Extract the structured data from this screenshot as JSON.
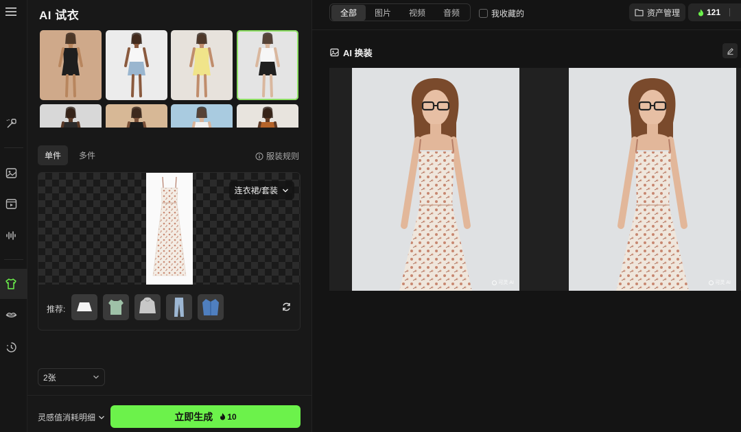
{
  "panel": {
    "title": "AI 试衣"
  },
  "models": [
    {
      "name": "model-1",
      "skin": "#b8865e",
      "bg": "#cfa98a",
      "top": "#1e1e1e",
      "bottom": "#1e1e1e"
    },
    {
      "name": "model-2",
      "skin": "#8a5a3e",
      "bg": "#ececec",
      "top": "#f7f7f7",
      "bottom": "#9ab6cf"
    },
    {
      "name": "model-3",
      "skin": "#c08d6c",
      "bg": "#e7e2dc",
      "top": "#f0e48a",
      "bottom": "#f0e48a"
    },
    {
      "name": "model-4",
      "skin": "#d9b79e",
      "bg": "#e4e4e4",
      "top": "#f6f6f6",
      "bottom": "#1f1f1f"
    },
    {
      "name": "model-5",
      "skin": "#5a3a28",
      "bg": "#d8d8d8",
      "top": "#2b2b2b",
      "bottom": "#2b2b2b"
    },
    {
      "name": "model-6",
      "skin": "#7a5038",
      "bg": "#d7b896",
      "top": "#1a1a1a",
      "bottom": "#1a1a1a"
    },
    {
      "name": "model-7",
      "skin": "#d9b49a",
      "bg": "#a9cbe0",
      "top": "#f2f2f2",
      "bottom": "#f2f2f2"
    },
    {
      "name": "model-8",
      "skin": "#5e3a26",
      "bg": "#e8e4de",
      "top": "#b5642a",
      "bottom": "#b5642a"
    }
  ],
  "tabs": {
    "single": "单件",
    "multi": "多件"
  },
  "rules": {
    "label": "服装规则"
  },
  "garment": {
    "category": "连衣裙/套装",
    "recommend_label": "推荐:"
  },
  "recommendations": [
    {
      "name": "white-skirt",
      "color": "#f4f4f4"
    },
    {
      "name": "green-shirt",
      "color": "#9fc2a8"
    },
    {
      "name": "grey-hoodie",
      "color": "#c8c8c8"
    },
    {
      "name": "jeans",
      "color": "#9db7d3"
    },
    {
      "name": "denim-jacket",
      "color": "#4f7fbf"
    }
  ],
  "count": {
    "value": "2张"
  },
  "footer": {
    "cost_label": "灵感值消耗明细",
    "generate_label": "立即生成",
    "generate_cost": "10"
  },
  "topbar": {
    "filters": [
      "全部",
      "图片",
      "视频",
      "音频"
    ],
    "favorites_label": "我收藏的",
    "assets_label": "资产管理",
    "credits": "121"
  },
  "section": {
    "title": "AI 换装"
  },
  "results": [
    {
      "name": "result-1",
      "watermark": "可灵 AI"
    },
    {
      "name": "result-2",
      "watermark": "可灵 AI"
    }
  ],
  "colors": {
    "accent": "#6cf24b",
    "background": "#141414",
    "panel": "#181818"
  }
}
